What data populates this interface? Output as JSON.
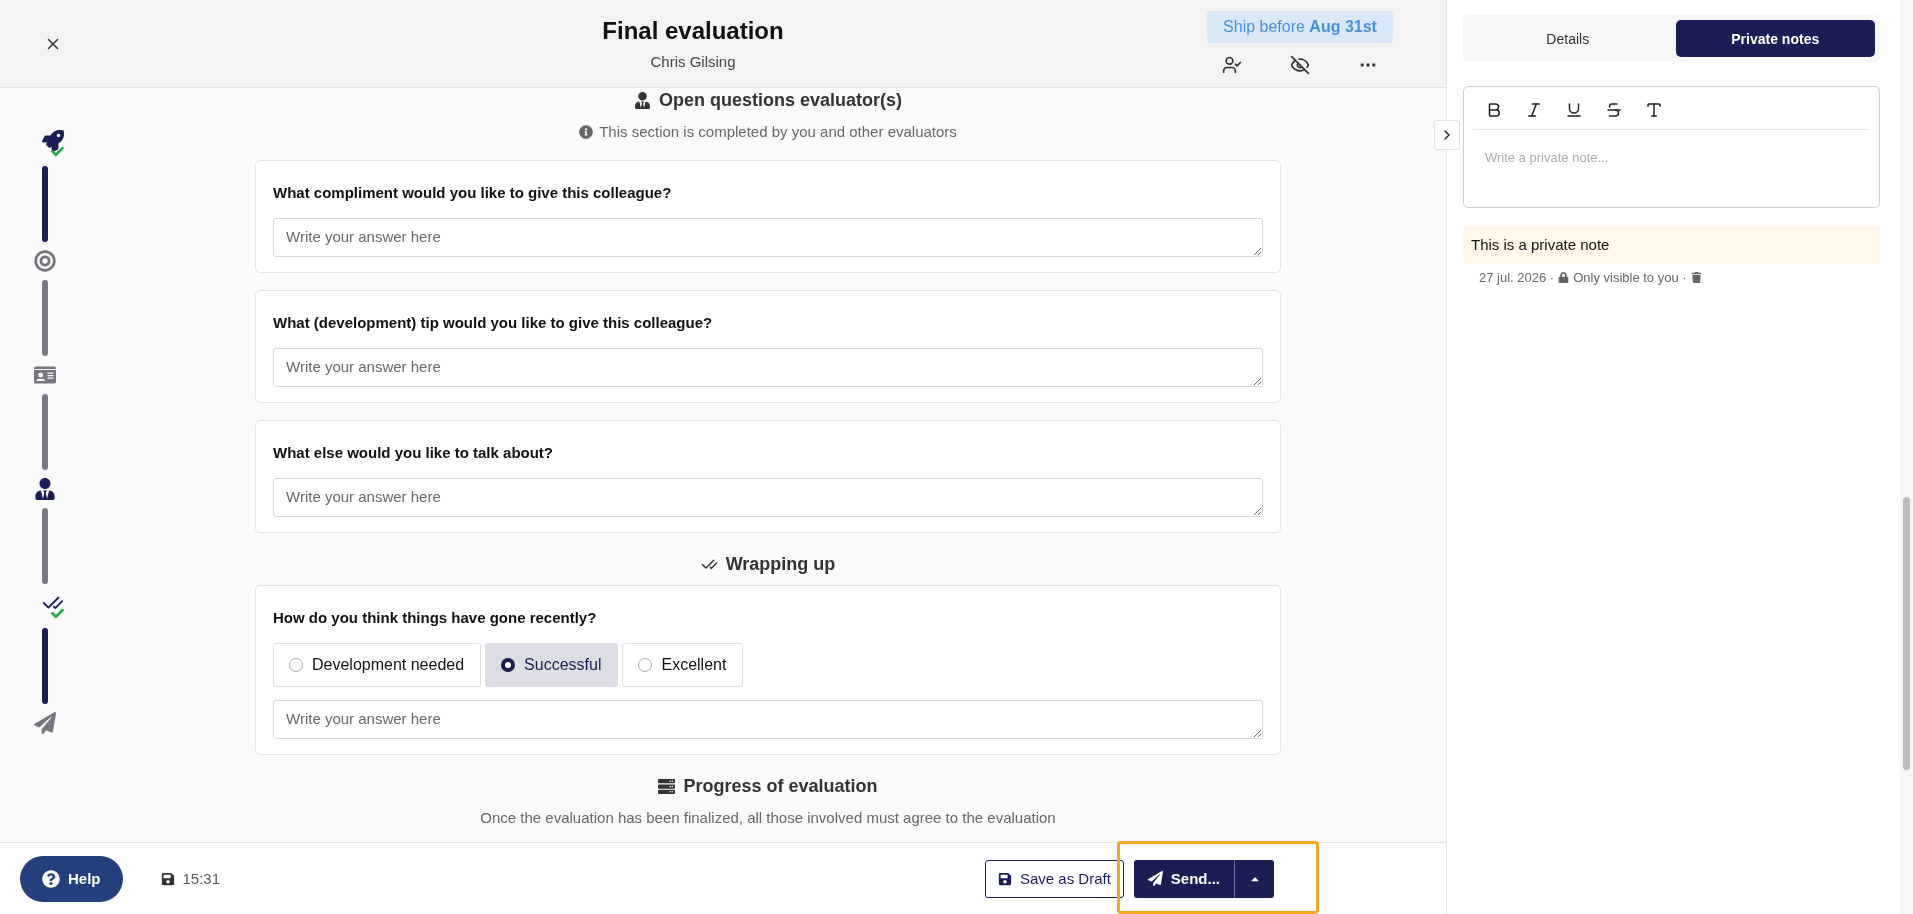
{
  "header": {
    "title": "Final evaluation",
    "subtitle": "Chris Gilsing",
    "badge": "Ship before **Aug 31st**"
  },
  "stepper": [
    {
      "kind": "rocket",
      "active": true,
      "completed": true,
      "line_active": true
    },
    {
      "kind": "target",
      "active": false,
      "completed": false,
      "line_active": false
    },
    {
      "kind": "id-card",
      "active": false,
      "completed": false,
      "line_active": false
    },
    {
      "kind": "person",
      "active": true,
      "completed": false,
      "line_active": false
    },
    {
      "kind": "checks",
      "active": true,
      "completed": true,
      "line_active": true
    },
    {
      "kind": "send",
      "active": false,
      "completed": false
    }
  ],
  "blocks": [
    {
      "kind": "heading",
      "title": "Open questions evaluator(s)",
      "note": "This section is completed by you and other evaluators"
    },
    {
      "kind": "question",
      "question": "What compliment would you like to give this colleague?",
      "placeholder": "Write your answer here"
    },
    {
      "kind": "question",
      "question": "What (development) tip would you like to give this colleague?",
      "placeholder": "Write your answer here"
    },
    {
      "kind": "question",
      "question": "What else would you like to talk about?",
      "placeholder": "Write your answer here"
    },
    {
      "kind": "heading",
      "title": "Wrapping up"
    },
    {
      "kind": "rating",
      "question": "How do you think things have gone recently?",
      "options": [
        {
          "label": "Development needed",
          "selected": false
        },
        {
          "label": "Successful",
          "selected": true
        },
        {
          "label": "Excellent",
          "selected": false
        }
      ],
      "placeholder": "Write your answer here"
    },
    {
      "kind": "heading",
      "title": "Progress of evaluation",
      "note": "Once the evaluation has been finalized, all those involved must agree to the evaluation"
    }
  ],
  "footer": {
    "help": "Help",
    "saved_time": "15:31",
    "save_draft": "Save as Draft",
    "send": "Send...",
    "send_highlighted": true
  },
  "side_panel": {
    "tabs": [
      {
        "label": "Details",
        "selected": false
      },
      {
        "label": "Private notes",
        "selected": true
      }
    ],
    "editor_placeholder": "Write a private note...",
    "notes": [
      {
        "text": "This is a private note",
        "date": "27 jul. 2026 ·",
        "visibility": "Only visible to you ·"
      }
    ]
  }
}
